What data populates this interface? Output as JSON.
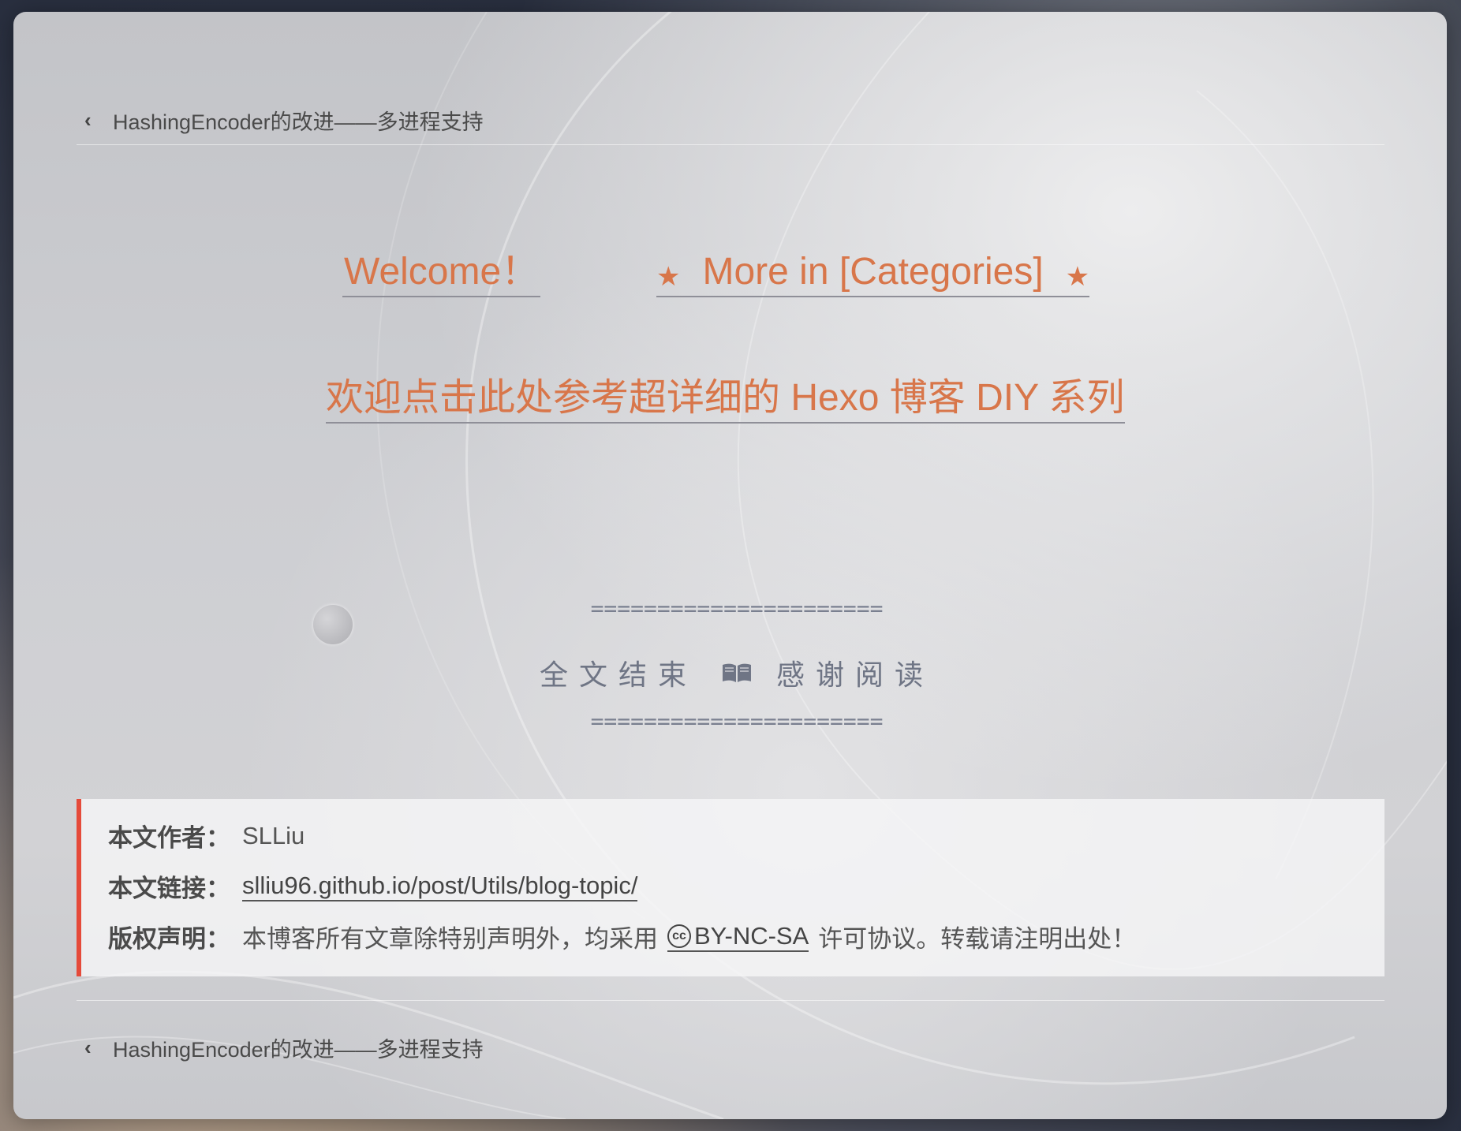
{
  "nav": {
    "prev_post_top": "HashingEncoder的改进——多进程支持",
    "prev_post_bottom": "HashingEncoder的改进——多进程支持"
  },
  "links": {
    "welcome": "Welcome！",
    "categories": "More in [Categories]",
    "diy_series": "欢迎点击此处参考超详细的 Hexo 博客 DIY 系列"
  },
  "ending": {
    "separator_top": "======================",
    "text_left": "全文结束",
    "book_icon": "book-icon",
    "text_right": "感谢阅读",
    "separator_bottom": "======================"
  },
  "copyright": {
    "author_label": "本文作者：",
    "author_value": "SLLiu",
    "link_label": "本文链接：",
    "link_value": "slliu96.github.io/post/Utils/blog-topic/",
    "license_label": "版权声明：",
    "license_prefix": "本博客所有文章除特别声明外，均采用",
    "license_badge": "BY-NC-SA",
    "license_suffix": "许可协议。转载请注明出处！"
  },
  "colors": {
    "accent_orange": "#d8764a",
    "border_red": "#e54a3a",
    "ending_gray": "#6f7585"
  }
}
